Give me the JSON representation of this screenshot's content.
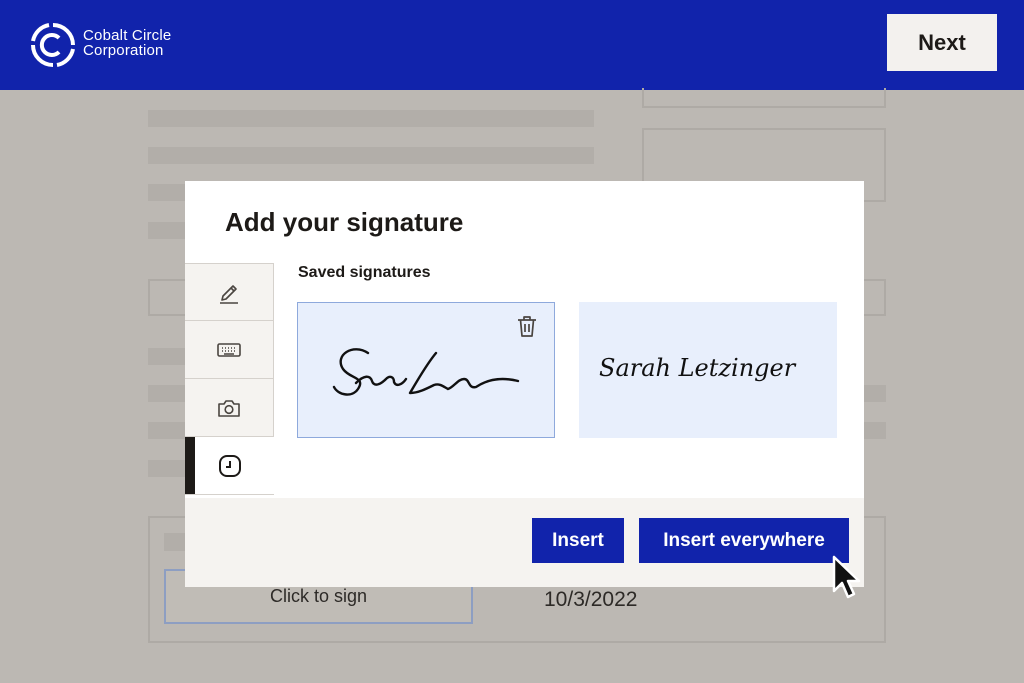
{
  "colors": {
    "brand": "#1123ab",
    "background": "#bcb8b3"
  },
  "header": {
    "company_line1": "Cobalt Circle",
    "company_line2": "Corporation",
    "next_label": "Next"
  },
  "document": {
    "click_to_sign": "Click to sign",
    "date": "10/3/2022"
  },
  "modal": {
    "title": "Add your signature",
    "tabs": [
      {
        "name": "draw",
        "icon": "pen-icon"
      },
      {
        "name": "type",
        "icon": "keyboard-icon"
      },
      {
        "name": "photo",
        "icon": "camera-icon"
      },
      {
        "name": "saved",
        "icon": "clock-icon",
        "active": true
      }
    ],
    "saved_label": "Saved signatures",
    "signatures": [
      {
        "kind": "initials",
        "selected": true,
        "icon": "trash-icon"
      },
      {
        "kind": "full-name",
        "text": "Sarah Letzinger"
      }
    ],
    "insert_label": "Insert",
    "insert_everywhere_label": "Insert everywhere"
  }
}
